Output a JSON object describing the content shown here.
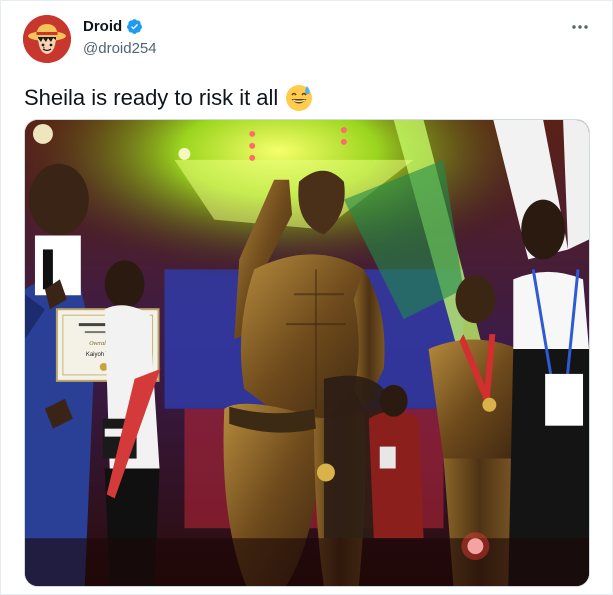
{
  "author": {
    "display_name": "Droid",
    "handle": "@droid254",
    "verified": true,
    "avatar_icon": "one-piece-straw-hat-avatar"
  },
  "tweet": {
    "text": "Sheila is ready to risk it all",
    "emoji": "sweat-smile-emoji"
  },
  "actions": {
    "more_icon": "more-horizontal-icon"
  },
  "media": {
    "certificate_name": "Kaiyoh Tom Link"
  },
  "colors": {
    "brand_blue": "#1d9bf0",
    "text_primary": "#0f1419",
    "text_secondary": "#536471",
    "border": "#cfd9de"
  }
}
